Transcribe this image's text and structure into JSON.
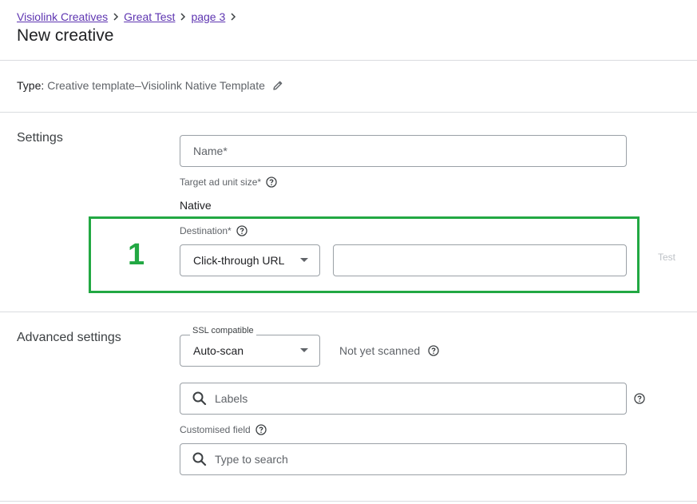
{
  "breadcrumb": {
    "items": [
      "Visiolink Creatives",
      "Great Test",
      "page 3"
    ]
  },
  "page_title": "New creative",
  "type_row": {
    "label": "Type:",
    "value": "Creative template–Visiolink Native Template",
    "icon": "edit-icon"
  },
  "settings": {
    "section_title": "Settings",
    "name_placeholder": "Name*",
    "target_size_label": "Target ad unit size*",
    "target_size_value": "Native",
    "destination_label": "Destination*",
    "destination_type": "Click-through URL",
    "destination_url": "",
    "test_label": "Test",
    "highlight_number": "1"
  },
  "advanced": {
    "section_title": "Advanced settings",
    "ssl_label": "SSL compatible",
    "ssl_value": "Auto-scan",
    "ssl_status": "Not yet scanned",
    "labels_placeholder": "Labels",
    "custom_field_label": "Customised field",
    "custom_field_placeholder": "Type to search"
  },
  "colors": {
    "link": "#5e35b1",
    "highlight": "#22a843",
    "border": "#9aa0a6",
    "divider": "#dadce0"
  }
}
